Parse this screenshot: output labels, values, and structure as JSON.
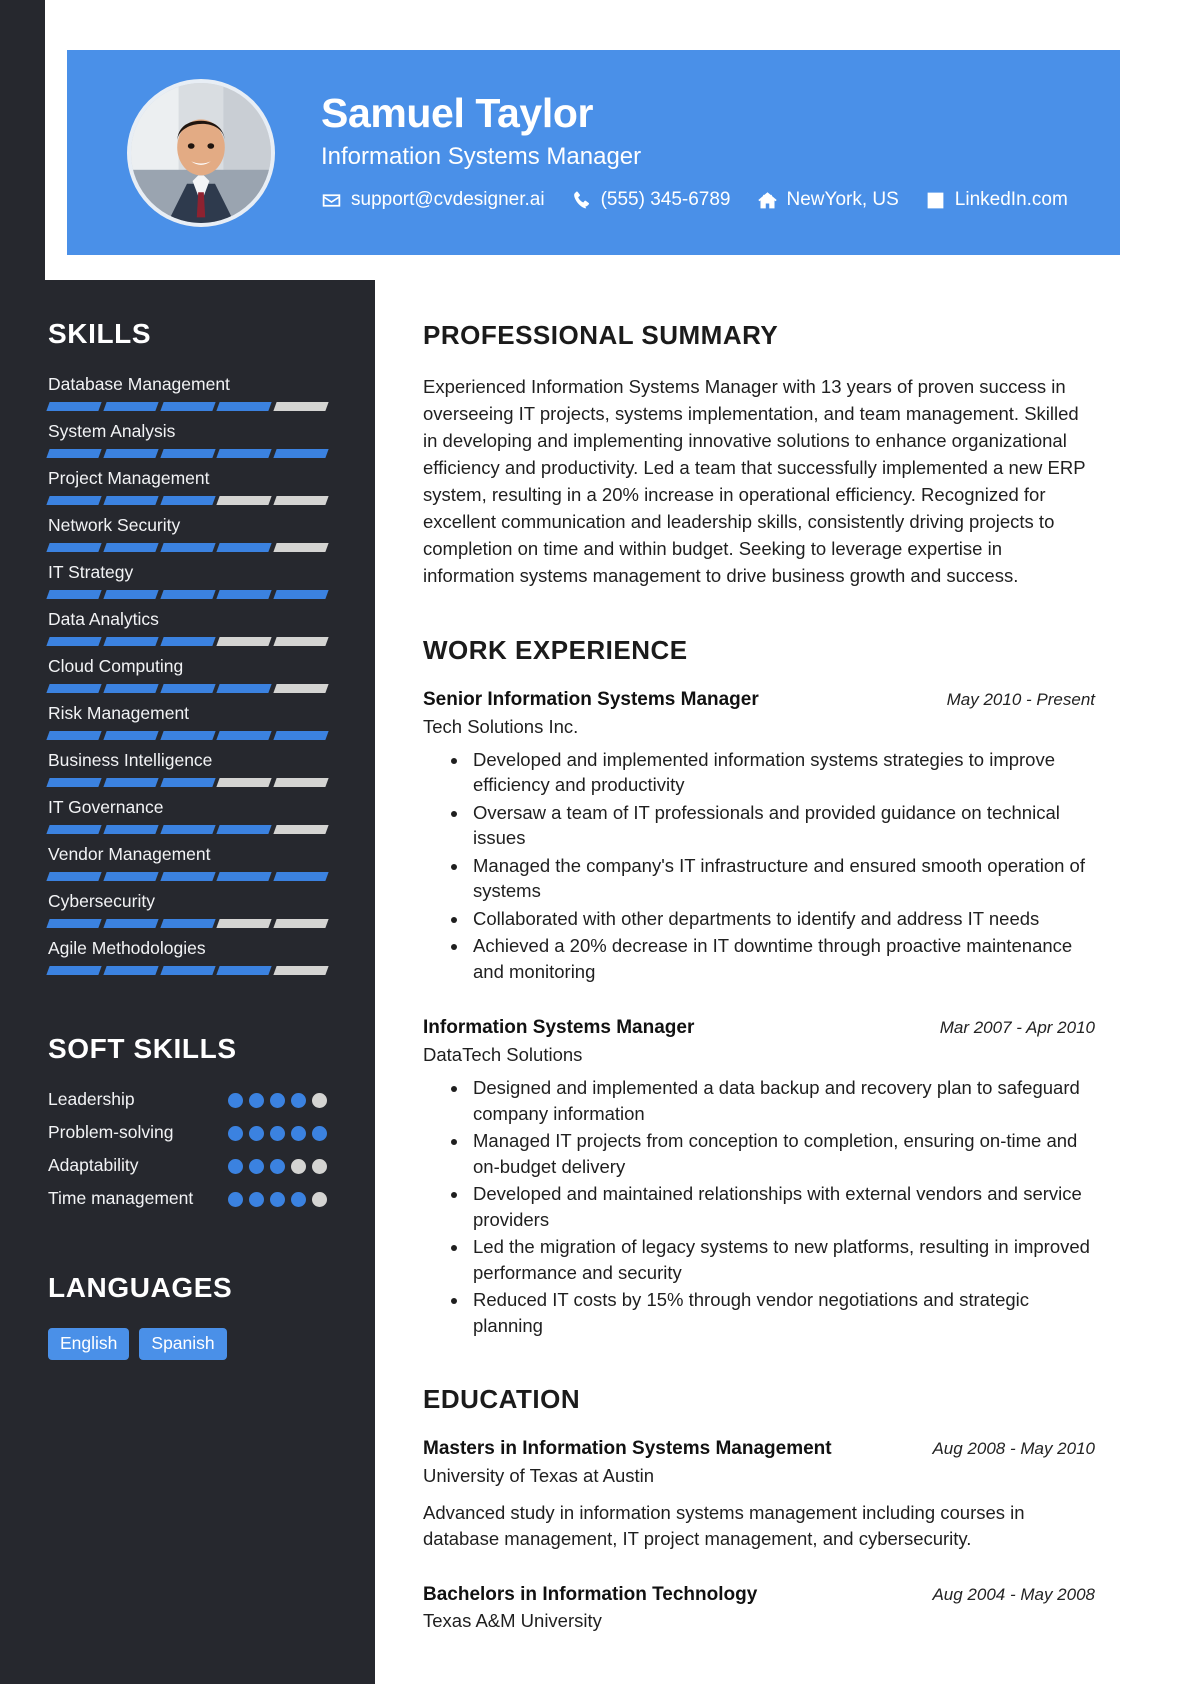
{
  "colors": {
    "accent": "#4a90e8",
    "accent_bar": "#3b82e0",
    "sidebar_bg": "#26282e",
    "muted_bar": "#d4d4d2"
  },
  "header": {
    "name": "Samuel Taylor",
    "job_title": "Information Systems Manager",
    "contacts": [
      {
        "icon": "envelope-icon",
        "text": "support@cvdesigner.ai"
      },
      {
        "icon": "phone-icon",
        "text": "(555) 345-6789"
      },
      {
        "icon": "home-icon",
        "text": "NewYork, US"
      },
      {
        "icon": "linkedin-icon",
        "text": "LinkedIn.com"
      }
    ]
  },
  "sidebar": {
    "skills_heading": "SKILLS",
    "skills": [
      {
        "name": "Database Management",
        "level": 4,
        "max": 5
      },
      {
        "name": "System Analysis",
        "level": 5,
        "max": 5
      },
      {
        "name": "Project Management",
        "level": 3,
        "max": 5
      },
      {
        "name": "Network Security",
        "level": 4,
        "max": 5
      },
      {
        "name": "IT Strategy",
        "level": 5,
        "max": 5
      },
      {
        "name": "Data Analytics",
        "level": 3,
        "max": 5
      },
      {
        "name": "Cloud Computing",
        "level": 4,
        "max": 5
      },
      {
        "name": "Risk Management",
        "level": 5,
        "max": 5
      },
      {
        "name": "Business Intelligence",
        "level": 3,
        "max": 5
      },
      {
        "name": "IT Governance",
        "level": 4,
        "max": 5
      },
      {
        "name": "Vendor Management",
        "level": 5,
        "max": 5
      },
      {
        "name": "Cybersecurity",
        "level": 3,
        "max": 5
      },
      {
        "name": "Agile Methodologies",
        "level": 4,
        "max": 5
      }
    ],
    "soft_skills_heading": "SOFT SKILLS",
    "soft_skills": [
      {
        "name": "Leadership",
        "level": 4,
        "max": 5
      },
      {
        "name": "Problem-solving",
        "level": 5,
        "max": 5
      },
      {
        "name": "Adaptability",
        "level": 3,
        "max": 5
      },
      {
        "name": "Time management",
        "level": 4,
        "max": 5
      }
    ],
    "languages_heading": "LANGUAGES",
    "languages": [
      "English",
      "Spanish"
    ]
  },
  "main": {
    "summary_heading": "PROFESSIONAL SUMMARY",
    "summary_text": "Experienced Information Systems Manager with 13 years of proven success in overseeing IT projects, systems implementation, and team management. Skilled in developing and implementing innovative solutions to enhance organizational efficiency and productivity. Led a team that successfully implemented a new ERP system, resulting in a 20% increase in operational efficiency. Recognized for excellent communication and leadership skills, consistently driving projects to completion on time and within budget. Seeking to leverage expertise in information systems management to drive business growth and success.",
    "work_heading": "WORK EXPERIENCE",
    "work": [
      {
        "title": "Senior Information Systems Manager",
        "date": "May 2010 - Present",
        "org": "Tech Solutions Inc.",
        "bullets": [
          "Developed and implemented information systems strategies to improve efficiency and productivity",
          "Oversaw a team of IT professionals and provided guidance on technical issues",
          "Managed the company's IT infrastructure and ensured smooth operation of systems",
          "Collaborated with other departments to identify and address IT needs",
          "Achieved a 20% decrease in IT downtime through proactive maintenance and monitoring"
        ]
      },
      {
        "title": "Information Systems Manager",
        "date": "Mar 2007 - Apr 2010",
        "org": "DataTech Solutions",
        "bullets": [
          "Designed and implemented a data backup and recovery plan to safeguard company information",
          "Managed IT projects from conception to completion, ensuring on-time and on-budget delivery",
          "Developed and maintained relationships with external vendors and service providers",
          "Led the migration of legacy systems to new platforms, resulting in improved performance and security",
          "Reduced IT costs by 15% through vendor negotiations and strategic planning"
        ]
      }
    ],
    "education_heading": "EDUCATION",
    "education": [
      {
        "title": "Masters in Information Systems Management",
        "date": "Aug 2008 - May 2010",
        "org": "University of Texas at Austin",
        "description": "Advanced study in information systems management including courses in database management, IT project management, and cybersecurity."
      },
      {
        "title": "Bachelors in Information Technology",
        "date": "Aug 2004 - May 2008",
        "org": "Texas A&M University",
        "description": ""
      }
    ]
  }
}
